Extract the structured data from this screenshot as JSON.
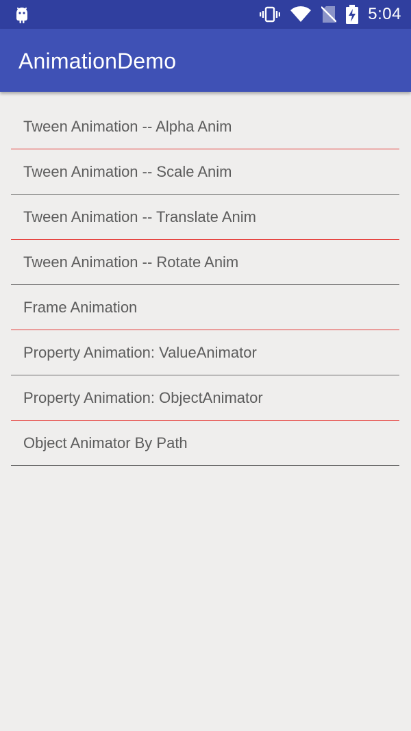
{
  "status_bar": {
    "app_icon": "android-icon",
    "icons": [
      "vibrate-icon",
      "wifi-icon",
      "no-sim-icon",
      "battery-charging-icon"
    ],
    "time": "5:04"
  },
  "app_bar": {
    "title": "AnimationDemo"
  },
  "list": {
    "items": [
      {
        "label": "Tween Animation -- Alpha Anim",
        "divider_color": "#e53935"
      },
      {
        "label": "Tween Animation -- Scale Anim",
        "divider_color": "#6b6b6b"
      },
      {
        "label": "Tween Animation -- Translate Anim",
        "divider_color": "#e53935"
      },
      {
        "label": "Tween Animation -- Rotate Anim",
        "divider_color": "#6b6b6b"
      },
      {
        "label": "Frame Animation",
        "divider_color": "#e53935"
      },
      {
        "label": "Property Animation: ValueAnimator",
        "divider_color": "#6b6b6b"
      },
      {
        "label": "Property Animation: ObjectAnimator",
        "divider_color": "#e53935"
      },
      {
        "label": "Object Animator By Path",
        "divider_color": "#6b6b6b"
      }
    ]
  },
  "colors": {
    "status_bar": "#303f9f",
    "app_bar": "#3f51b5",
    "background": "#efeeed",
    "text": "#5c5c5c"
  }
}
